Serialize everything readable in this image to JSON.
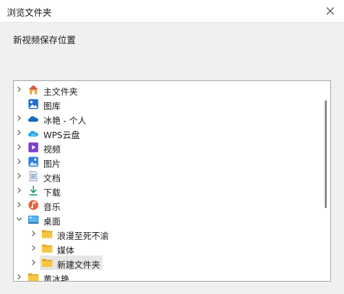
{
  "window": {
    "title": "浏览文件夹"
  },
  "dialog": {
    "prompt": "新视频保存位置"
  },
  "tree": {
    "items": [
      {
        "label": "主文件夹",
        "icon": "home-icon",
        "expander": "collapsed"
      },
      {
        "label": "图库",
        "icon": "gallery-icon",
        "expander": "none"
      },
      {
        "label": "冰艳 - 个人",
        "icon": "onedrive-cloud-icon",
        "expander": "collapsed"
      },
      {
        "label": "WPS云盘",
        "icon": "wps-cloud-icon",
        "expander": "collapsed"
      },
      {
        "label": "视频",
        "icon": "videos-icon",
        "expander": "collapsed"
      },
      {
        "label": "图片",
        "icon": "pictures-icon",
        "expander": "collapsed"
      },
      {
        "label": "文档",
        "icon": "documents-icon",
        "expander": "collapsed"
      },
      {
        "label": "下载",
        "icon": "downloads-icon",
        "expander": "collapsed"
      },
      {
        "label": "音乐",
        "icon": "music-icon",
        "expander": "collapsed"
      },
      {
        "label": "桌面",
        "icon": "desktop-icon",
        "expander": "expanded"
      },
      {
        "label": "浪漫至死不渝",
        "icon": "folder-icon",
        "expander": "collapsed"
      },
      {
        "label": "媒体",
        "icon": "folder-icon",
        "expander": "collapsed"
      },
      {
        "label": "新建文件夹",
        "icon": "folder-icon",
        "expander": "collapsed",
        "selected": true
      },
      {
        "label": "黄冰艳",
        "icon": "folder-icon",
        "expander": "collapsed"
      }
    ]
  },
  "colors": {
    "selection": "#e6e6e6",
    "folder": "#f8c640",
    "accent": "#0067c0"
  }
}
